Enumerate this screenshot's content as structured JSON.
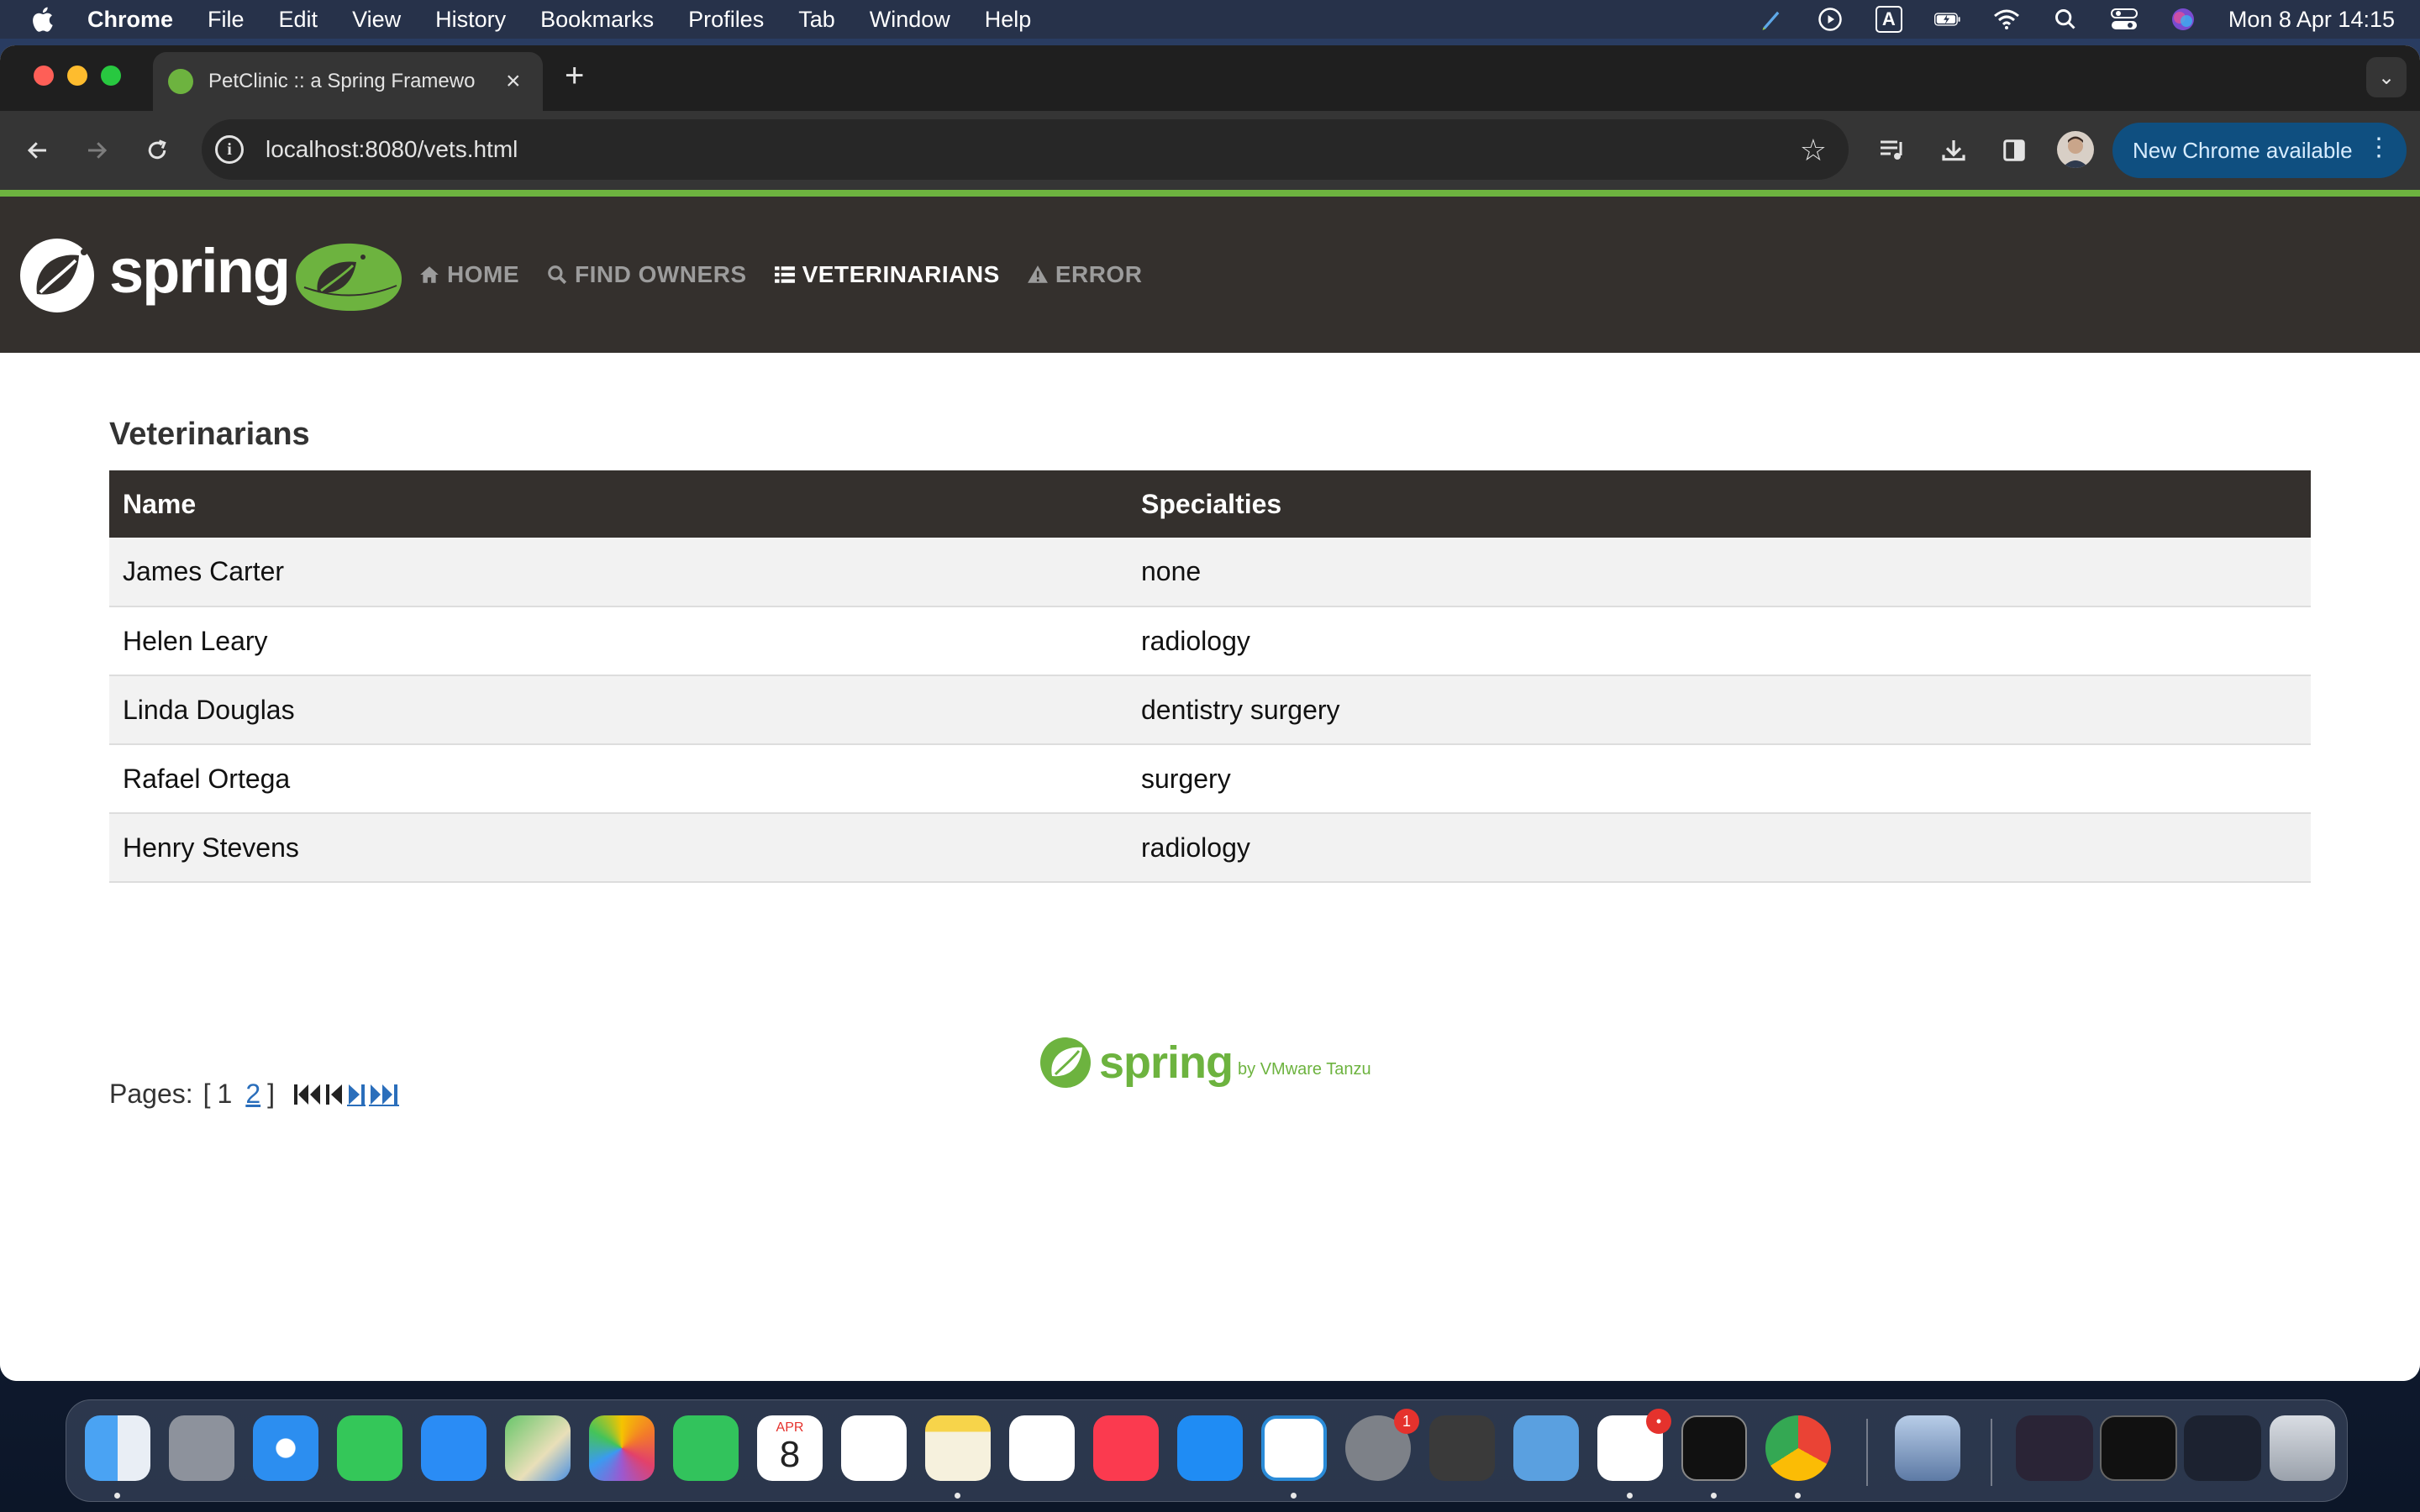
{
  "menubar": {
    "items": [
      "Chrome",
      "File",
      "Edit",
      "View",
      "History",
      "Bookmarks",
      "Profiles",
      "Tab",
      "Window",
      "Help"
    ],
    "clock": "Mon 8 Apr  14:15",
    "input_source": "A"
  },
  "browser": {
    "tab_title": "PetClinic :: a Spring Framewo",
    "url": "localhost:8080/vets.html",
    "update_label": "New Chrome available"
  },
  "app": {
    "logo_word": "spring",
    "nav": [
      {
        "label": "HOME",
        "icon": "home-icon"
      },
      {
        "label": "FIND OWNERS",
        "icon": "search-icon"
      },
      {
        "label": "VETERINARIANS",
        "icon": "list-icon"
      },
      {
        "label": "ERROR",
        "icon": "warning-icon"
      }
    ],
    "active_nav": "VETERINARIANS",
    "heading": "Veterinarians",
    "table": {
      "columns": [
        "Name",
        "Specialties"
      ],
      "rows": [
        {
          "name": "James Carter",
          "specialties": "none"
        },
        {
          "name": "Helen Leary",
          "specialties": "radiology"
        },
        {
          "name": "Linda Douglas",
          "specialties": "dentistry surgery"
        },
        {
          "name": "Rafael Ortega",
          "specialties": "surgery"
        },
        {
          "name": "Henry Stevens",
          "specialties": "radiology"
        }
      ]
    },
    "pagination": {
      "label": "Pages:",
      "open": "[",
      "close": "]",
      "current": "1",
      "other": "2"
    },
    "footer": {
      "word": "spring",
      "by": "by VMware Tanzu"
    }
  },
  "dock": {
    "calendar_month": "APR",
    "calendar_day": "8",
    "badges": {
      "system_settings": "1",
      "slack": "•"
    }
  },
  "colors": {
    "spring_green": "#6db33f",
    "navbar_bg": "#34302d",
    "link_blue": "#2a6ebb",
    "update_button": "#0f4f80"
  }
}
